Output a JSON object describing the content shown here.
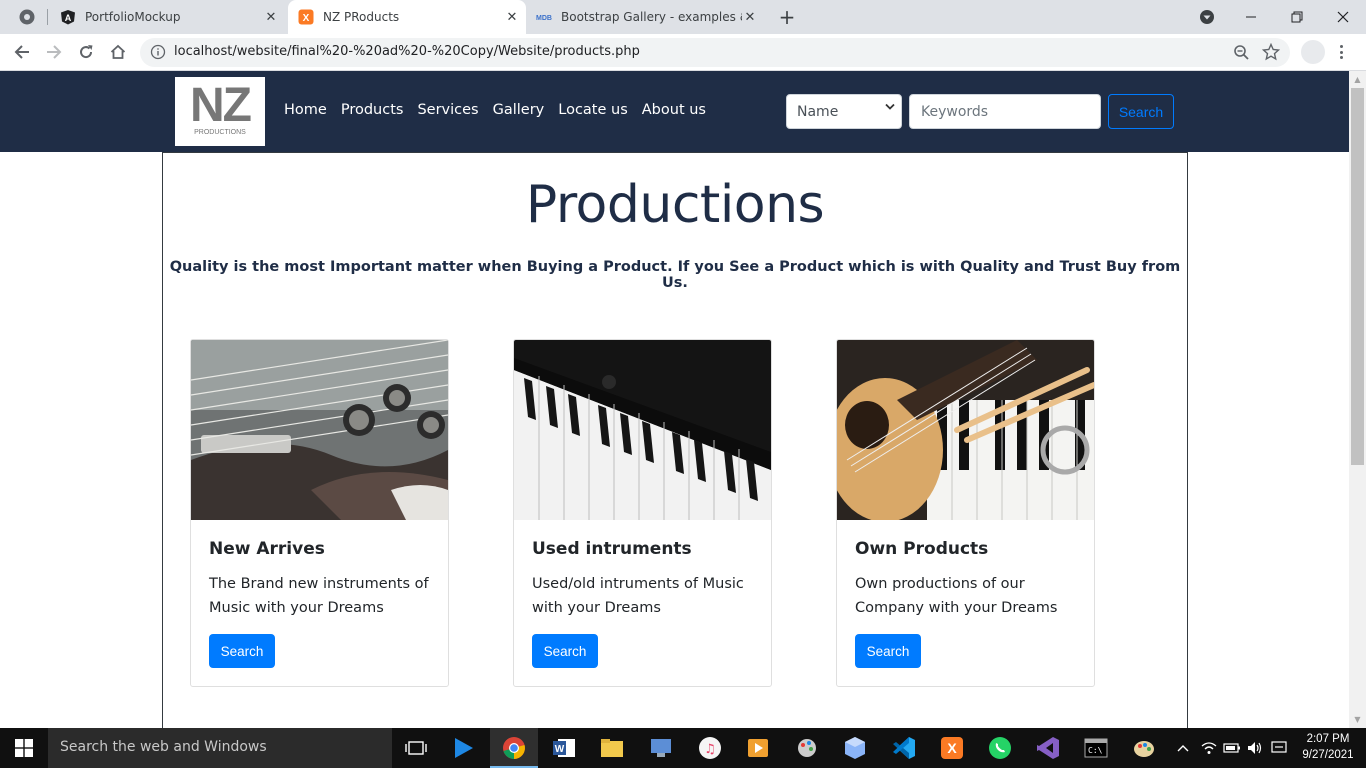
{
  "browser": {
    "tabs": [
      {
        "title": "PortfolioMockup",
        "icon": "angular-icon"
      },
      {
        "title": "NZ PRoducts",
        "icon": "xampp-icon"
      },
      {
        "title": "Bootstrap Gallery - examples & tu",
        "icon": "mdb-icon"
      }
    ],
    "url": "localhost/website/final%20-%20ad%20-%20Copy/Website/products.php"
  },
  "site": {
    "logo": {
      "text": "NZ",
      "subtext": "PRODUCTIONS"
    },
    "nav": [
      "Home",
      "Products",
      "Services",
      "Gallery",
      "Locate us",
      "About us"
    ],
    "search": {
      "select_value": "Name",
      "keywords_placeholder": "Keywords",
      "button": "Search"
    }
  },
  "main": {
    "title": "Productions",
    "tagline": "Quality is the most Important matter when Buying a Product. If you See a Product which is with Quality and Trust Buy from Us.",
    "cards": [
      {
        "title": "New Arrives",
        "text": "The Brand new instruments of Music with your Dreams",
        "button": "Search",
        "image": "electric-guitar-photo"
      },
      {
        "title": "Used intruments",
        "text": "Used/old intruments of Music with your Dreams",
        "button": "Search",
        "image": "piano-keys-photo"
      },
      {
        "title": "Own Products",
        "text": "Own productions of our Company with your Dreams",
        "button": "Search",
        "image": "ukulele-piano-photo"
      }
    ]
  },
  "taskbar": {
    "search_placeholder": "Search the web and Windows",
    "time": "2:07 PM",
    "date": "9/27/2021"
  },
  "colors": {
    "navbar": "#1f2d46",
    "primary": "#007bff",
    "heading": "#1f2d46"
  }
}
